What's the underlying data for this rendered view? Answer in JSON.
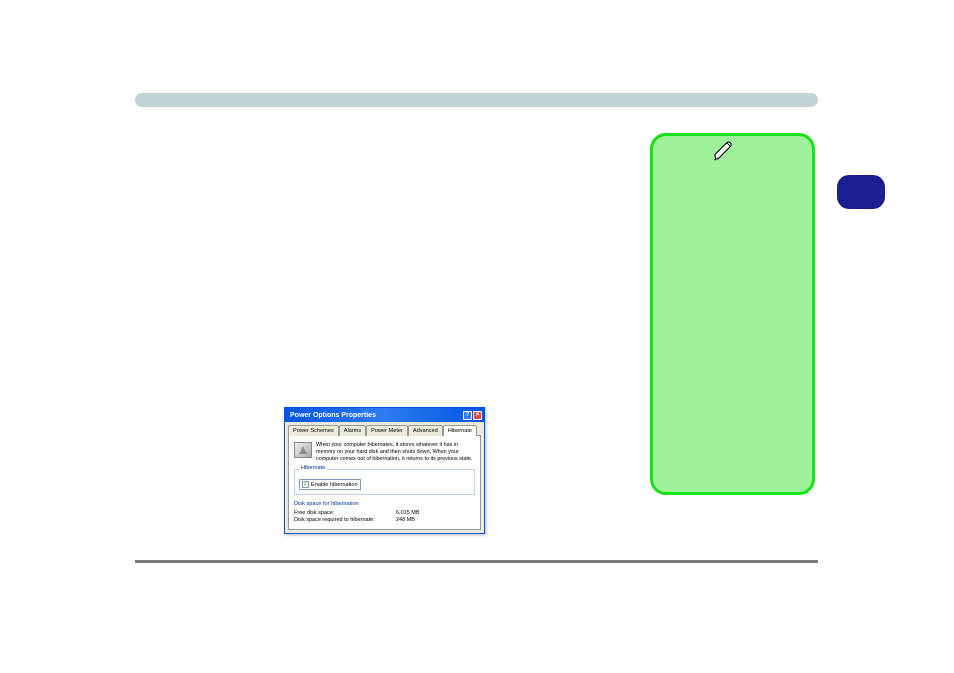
{
  "dialog": {
    "title": "Power Options Properties",
    "tabs": [
      "Power Schemes",
      "Alarms",
      "Power Meter",
      "Advanced",
      "Hibernate"
    ],
    "description": "When your computer hibernates, it stores whatever it has in memory on your hard disk and then shuts down. When your computer comes out of hibernation, it returns to its previous state.",
    "hibernate_section": "Hibernate",
    "enable_label": "Enable hibernation",
    "disk_section": "Disk space for hibernation",
    "free_space_label": "Free disk space:",
    "free_space_value": "6,015 MB",
    "req_space_label": "Disk space required to hibernate:",
    "req_space_value": "248 MB"
  }
}
